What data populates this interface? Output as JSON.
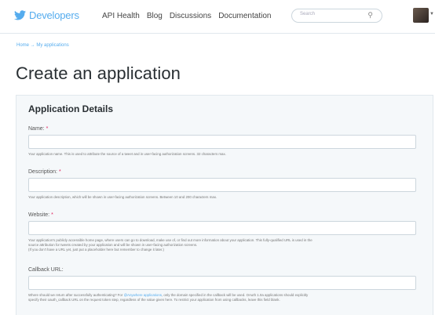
{
  "header": {
    "brand": "Developers",
    "nav": [
      "API Health",
      "Blog",
      "Discussions",
      "Documentation"
    ],
    "search_placeholder": "Search"
  },
  "breadcrumb": "Home → My applications",
  "page_title": "Create an application",
  "section_title": "Application Details",
  "fields": [
    {
      "label": "Name:",
      "value": "",
      "help": "Your application name. This is used to attribute the source of a tweet and in user-facing authorization screens. 32 characters max."
    },
    {
      "label": "Description:",
      "value": "",
      "help": "Your application description, which will be shown in user-facing authorization screens. Between 10 and 200 characters max."
    },
    {
      "label": "Website:",
      "value": "",
      "help1": "Your application's publicly accessible home page, where users can go to download, make use of, or find out more information about your application. This fully-qualified URL is used in the",
      "help2": "source attribution for tweets created by your application and will be shown in user-facing authorization screens.",
      "help3": "(If you don't have a URL yet, just put a placeholder here but remember to change it later.)"
    },
    {
      "label": "Callback URL:",
      "value": "",
      "help1_a": "Where should we return after successfully authenticating? For",
      "help1_link": "@Anywhere applications",
      "help1_b": ", only the domain specified in the callback will be used. OAuth 1.0a applications should explicitly",
      "help2": "specify their oauth_callback URL on the request token step, regardless of the value given here. To restrict your application from using callbacks, leave this field blank."
    }
  ],
  "colors": {
    "accent": "#55acee",
    "required": "#e0245e",
    "panel_bg": "#f5f8fa"
  }
}
